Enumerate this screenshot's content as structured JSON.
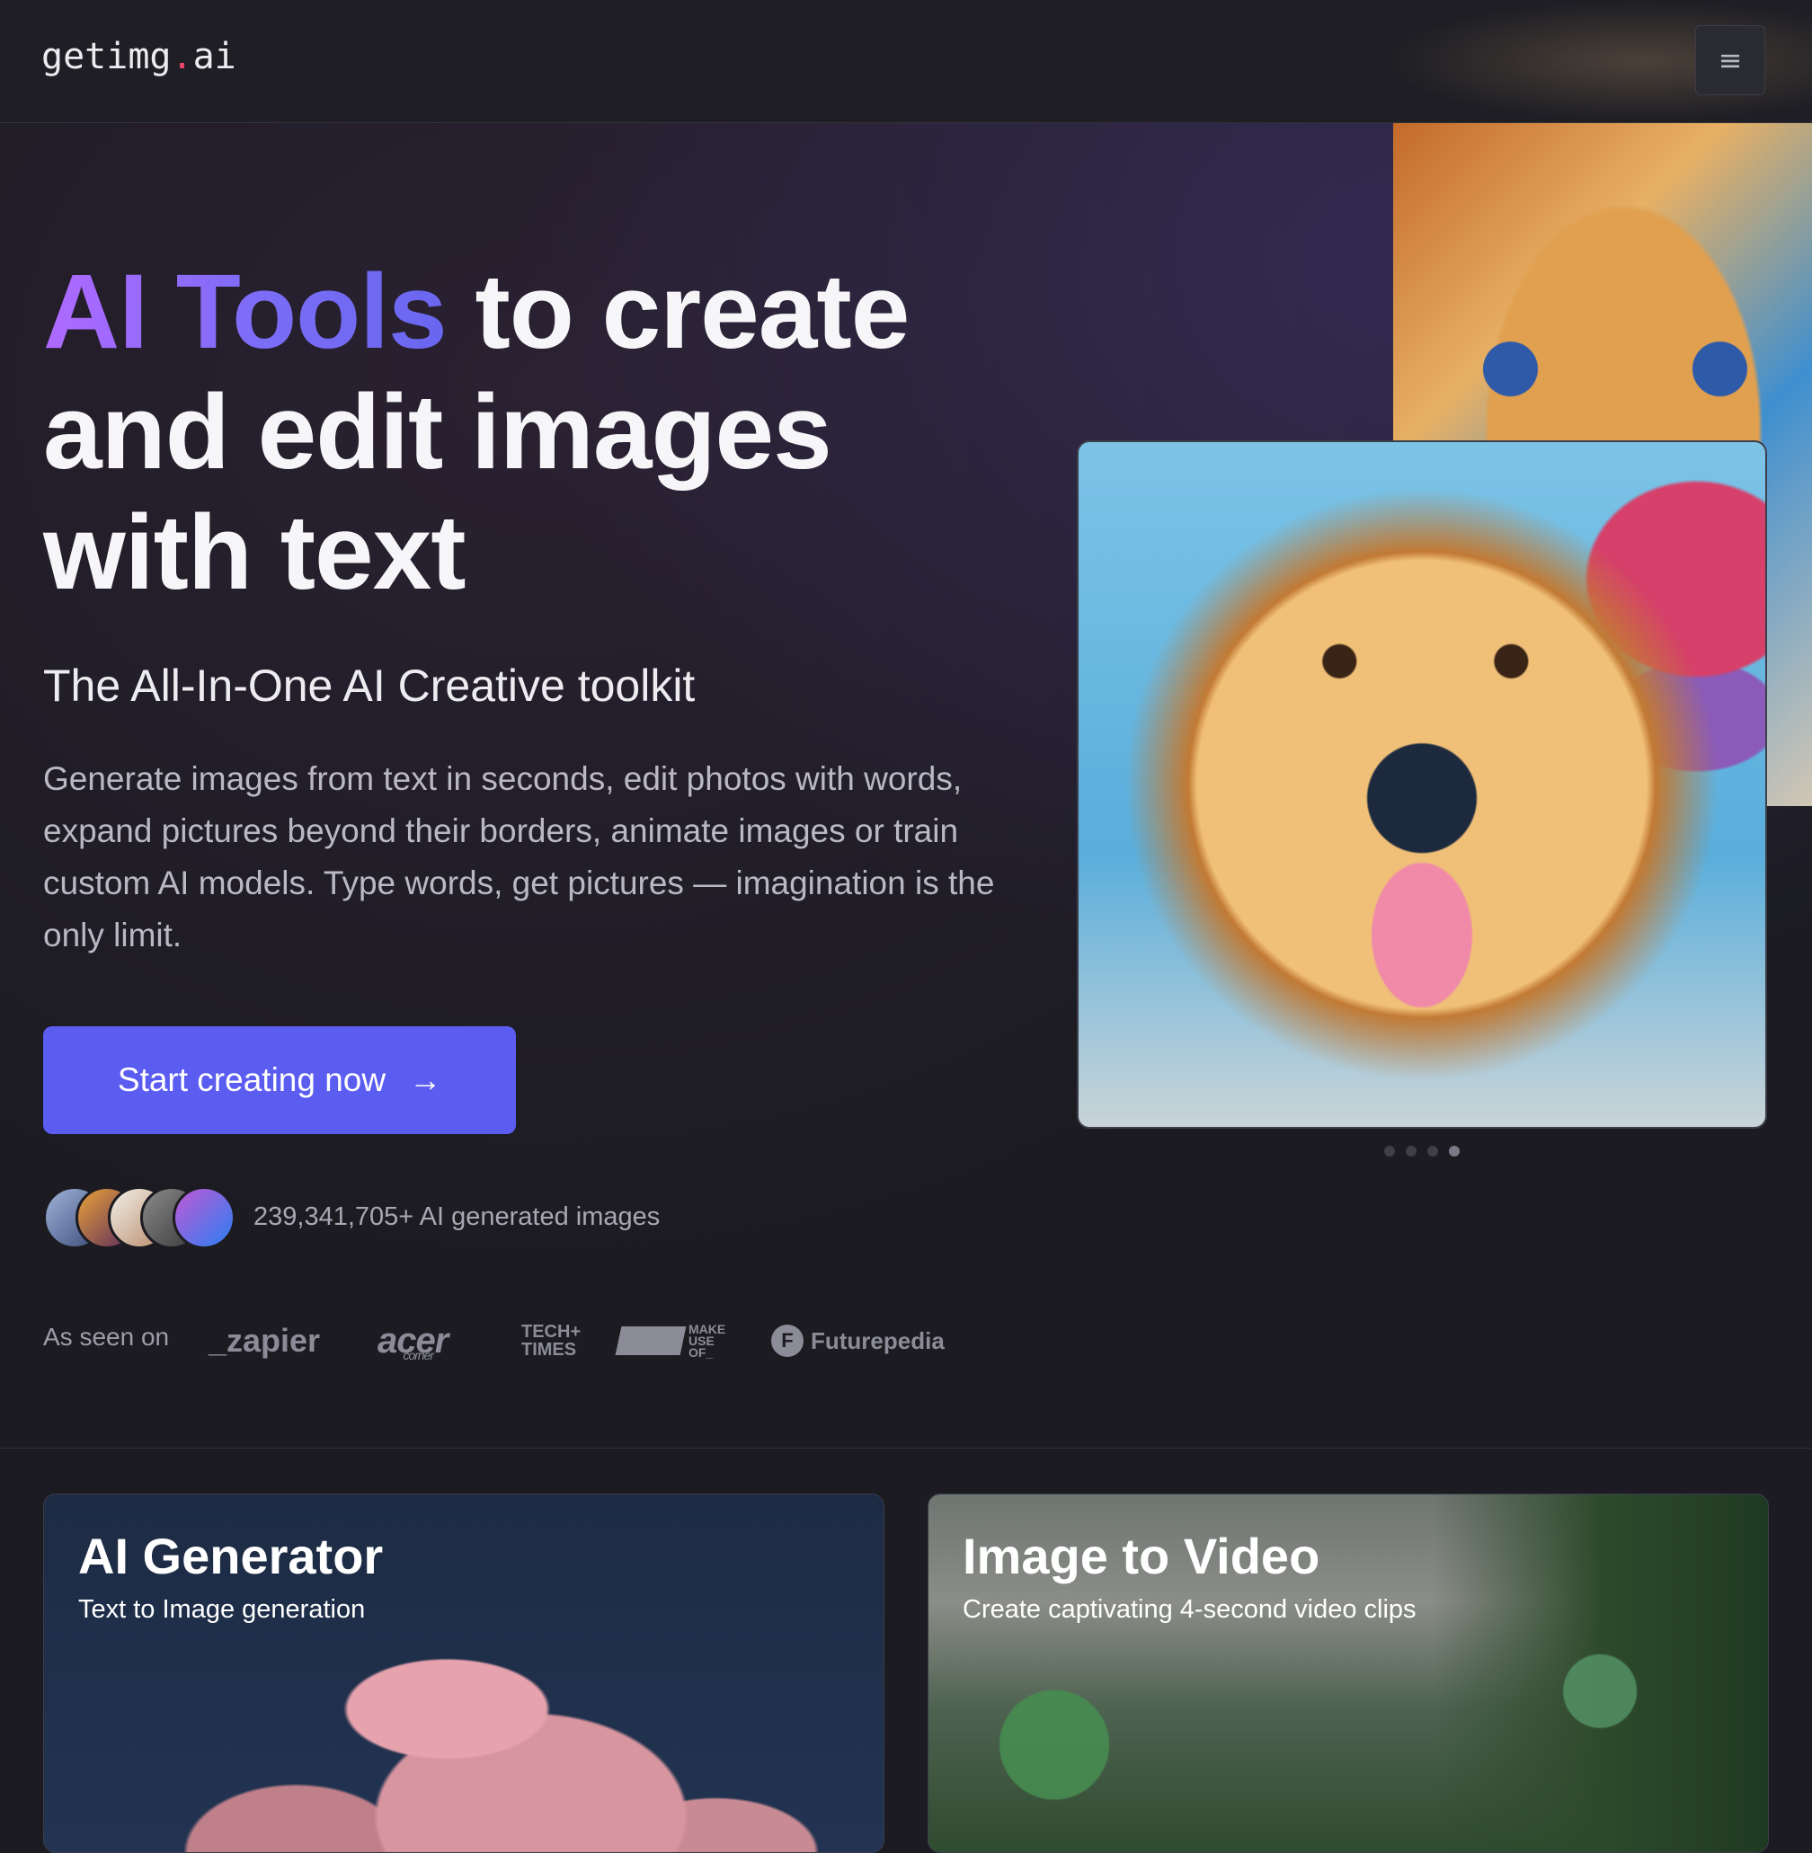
{
  "header": {
    "logo_main": "getimg",
    "logo_dot": ".",
    "logo_suffix": "ai",
    "menu_icon": "hamburger-menu-icon",
    "menu_glyph": "≡"
  },
  "hero": {
    "headline_highlight": "AI Tools",
    "headline_rest": " to create and edit images with text",
    "subheading": "The All-In-One AI Creative toolkit",
    "description": "Generate images from text in seconds, edit photos with words, expand pictures beyond their borders, animate images or train custom AI models. Type words, get pictures — imagination is the only limit.",
    "cta_label": "Start creating now",
    "cta_icon": "arrow-right-icon",
    "cta_glyph": "→",
    "stats_text": "239,341,705+ AI generated images",
    "avatar_count": 5,
    "carousel": {
      "slides": 4,
      "active_index": 3
    }
  },
  "as_seen_on": {
    "label": "As seen on",
    "brands": {
      "zapier": "_zapier",
      "acer": "acer",
      "acer_sub": "corner",
      "techtimes_line1": "TECH+",
      "techtimes_line2": "TIMES",
      "muo_line1": "MAKE",
      "muo_line2": "USE",
      "muo_line3": "OF_",
      "futurepedia": "Futurepedia",
      "futurepedia_mark": "F"
    }
  },
  "features": [
    {
      "title": "AI Generator",
      "subtitle": "Text to Image generation"
    },
    {
      "title": "Image to Video",
      "subtitle": "Create captivating 4-second video clips"
    }
  ],
  "colors": {
    "background": "#1b1b21",
    "accent": "#5b5cf0",
    "gradient_start": "#b069ff",
    "gradient_end": "#6a66f0",
    "logo_dot": "#e8476a"
  }
}
